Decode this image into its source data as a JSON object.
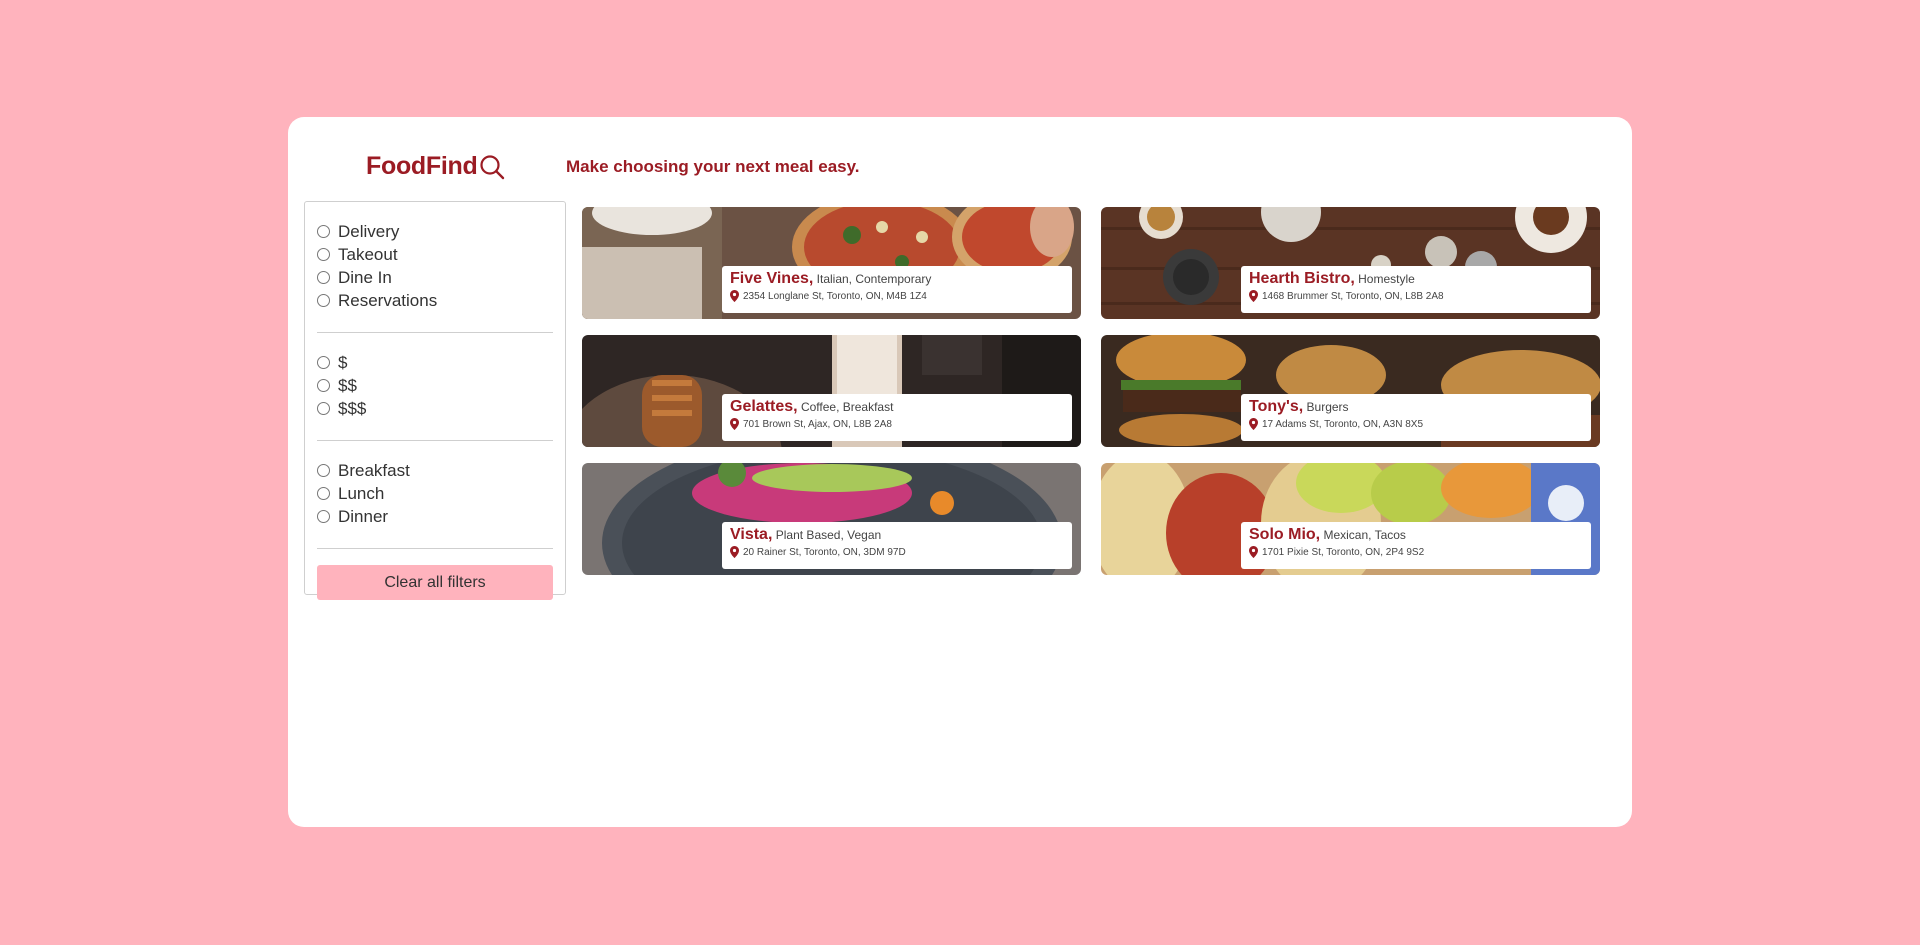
{
  "header": {
    "logo_text": "FoodFind",
    "tagline": "Make choosing your next meal easy."
  },
  "filters": {
    "service": [
      "Delivery",
      "Takeout",
      "Dine In",
      "Reservations"
    ],
    "price": [
      "$",
      "$$",
      "$$$"
    ],
    "meal": [
      "Breakfast",
      "Lunch",
      "Dinner"
    ],
    "clear_label": "Clear all filters"
  },
  "restaurants": [
    {
      "name": "Five Vines,",
      "cuisine": "Italian, Contemporary",
      "address": "2354 Longlane St, Toronto, ON, M4B 1Z4",
      "photo": "pizza"
    },
    {
      "name": "Hearth Bistro,",
      "cuisine": "Homestyle",
      "address": "1468 Brummer St, Toronto, ON, L8B 2A8",
      "photo": "table"
    },
    {
      "name": "Gelattes,",
      "cuisine": "Coffee, Breakfast",
      "address": "701 Brown St, Ajax, ON, L8B 2A8",
      "photo": "coffee"
    },
    {
      "name": "Tony's,",
      "cuisine": "Burgers",
      "address": "17 Adams St, Toronto, ON, A3N 8X5",
      "photo": "burgers"
    },
    {
      "name": "Vista,",
      "cuisine": "Plant Based, Vegan",
      "address": "20 Rainer St, Toronto, ON, 3DM 97D",
      "photo": "salad"
    },
    {
      "name": "Solo Mio,",
      "cuisine": "Mexican, Tacos",
      "address": "1701 Pixie St, Toronto, ON, 2P4 9S2",
      "photo": "tacos"
    }
  ],
  "colors": {
    "background": "#ffb3bd",
    "brand": "#9b1c24",
    "button": "#ffb3bd"
  }
}
